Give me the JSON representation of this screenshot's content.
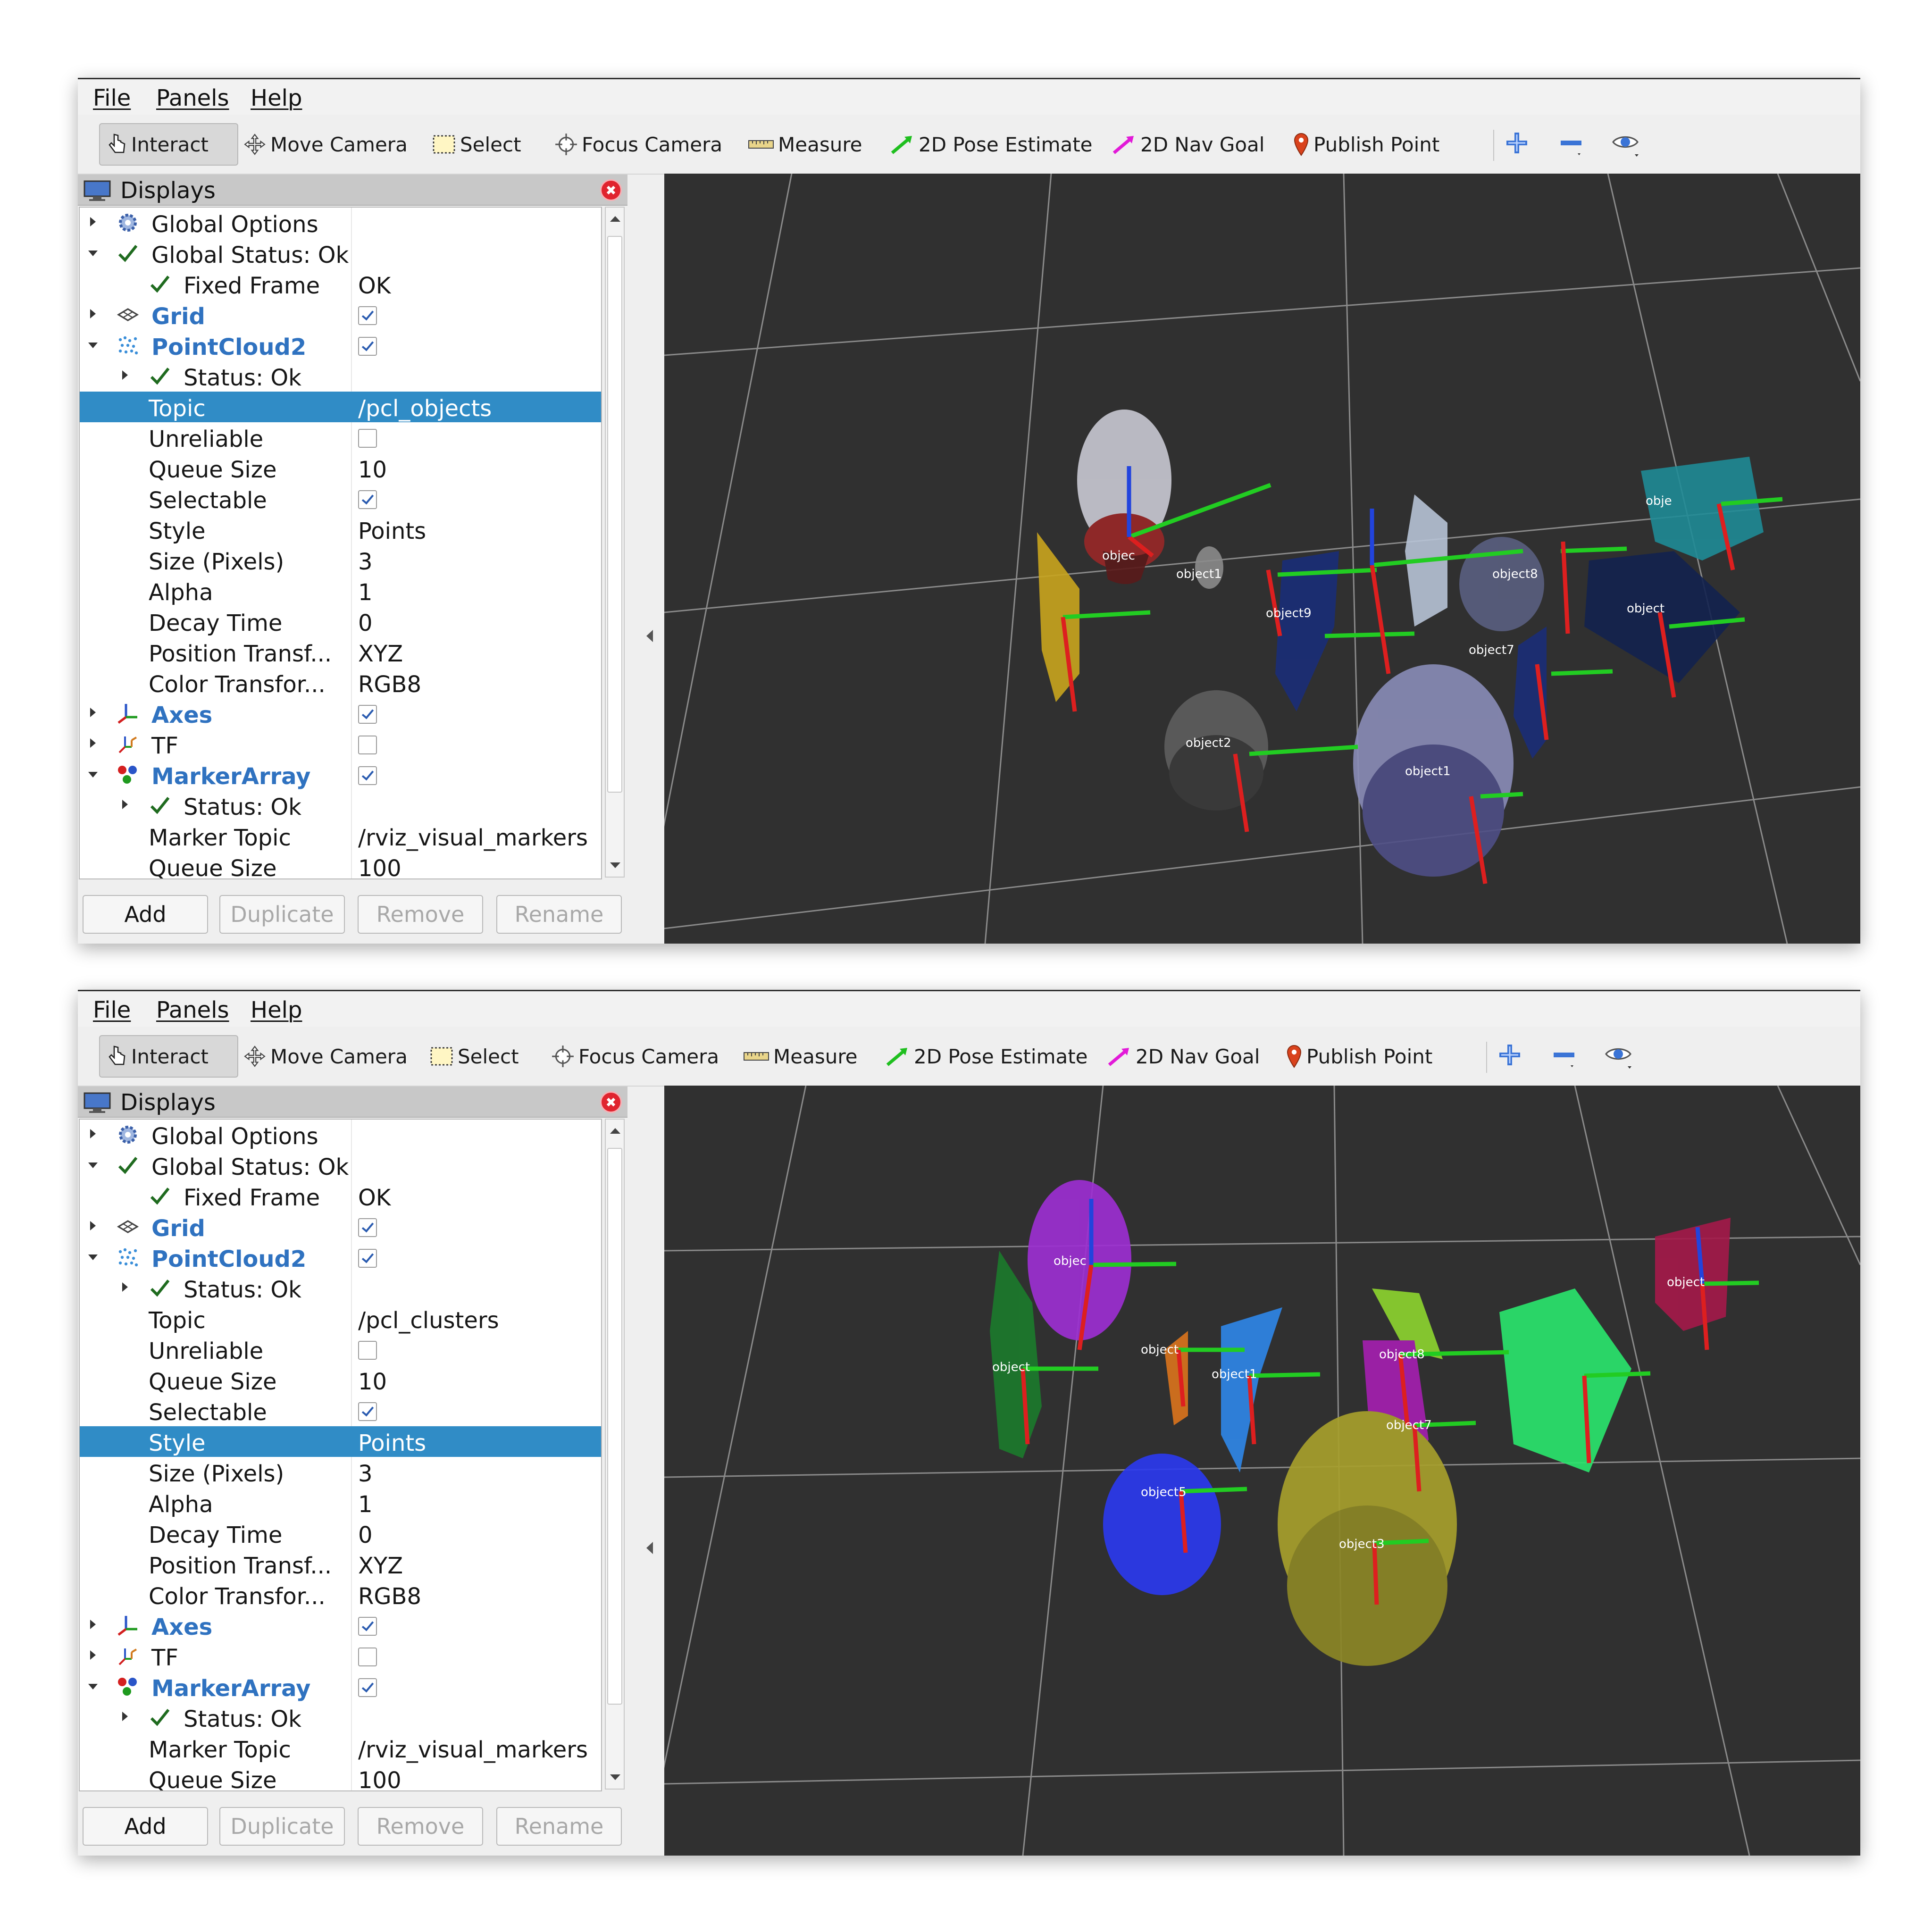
{
  "menu": [
    "File",
    "Panels",
    "Help"
  ],
  "toolbar": {
    "interact": "Interact",
    "move_camera": "Move Camera",
    "select": "Select",
    "focus_camera": "Focus Camera",
    "measure": "Measure",
    "pose_estimate": "2D Pose Estimate",
    "nav_goal": "2D Nav Goal",
    "publish_point": "Publish Point",
    "icons": [
      "plus-icon",
      "minus-icon",
      "eye-icon"
    ]
  },
  "panel": {
    "title": "Displays",
    "buttons": {
      "add": "Add",
      "duplicate": "Duplicate",
      "remove": "Remove",
      "rename": "Rename"
    }
  },
  "colors": {
    "selection": "#308cc6",
    "display_name": "#2f72c0",
    "viewport": "#303030"
  },
  "window1": {
    "selected_row": "Topic",
    "tree": {
      "global_options": "Global Options",
      "global_status": "Global Status: Ok",
      "fixed_frame": "Fixed Frame",
      "fixed_frame_value": "OK",
      "grid": "Grid",
      "pointcloud2": "PointCloud2",
      "status_ok": "Status: Ok",
      "topic": "Topic",
      "topic_value": "/pcl_objects",
      "unreliable": "Unreliable",
      "queue_size": "Queue Size",
      "queue_size_value": "10",
      "selectable": "Selectable",
      "style": "Style",
      "style_value": "Points",
      "size_pixels": "Size (Pixels)",
      "size_pixels_value": "3",
      "alpha": "Alpha",
      "alpha_value": "1",
      "decay_time": "Decay Time",
      "decay_time_value": "0",
      "position_transform": "Position Transf...",
      "position_transform_value": "XYZ",
      "color_transform": "Color Transfor...",
      "color_transform_value": "RGB8",
      "axes": "Axes",
      "tf": "TF",
      "marker_array": "MarkerArray",
      "marker_status": "Status: Ok",
      "marker_topic": "Marker Topic",
      "marker_topic_value": "/rviz_visual_markers",
      "marker_queue": "Queue Size",
      "marker_queue_value": "100"
    },
    "labels": [
      "objec",
      "object1",
      "object9",
      "object8",
      "object7",
      "obje",
      "object2",
      "object1",
      "object"
    ]
  },
  "window2": {
    "selected_row": "Style",
    "tree": {
      "global_options": "Global Options",
      "global_status": "Global Status: Ok",
      "fixed_frame": "Fixed Frame",
      "fixed_frame_value": "OK",
      "grid": "Grid",
      "pointcloud2": "PointCloud2",
      "status_ok": "Status: Ok",
      "topic": "Topic",
      "topic_value": "/pcl_clusters",
      "unreliable": "Unreliable",
      "queue_size": "Queue Size",
      "queue_size_value": "10",
      "selectable": "Selectable",
      "style": "Style",
      "style_value": "Points",
      "size_pixels": "Size (Pixels)",
      "size_pixels_value": "3",
      "alpha": "Alpha",
      "alpha_value": "1",
      "decay_time": "Decay Time",
      "decay_time_value": "0",
      "position_transform": "Position Transf...",
      "position_transform_value": "XYZ",
      "color_transform": "Color Transfor...",
      "color_transform_value": "RGB8",
      "axes": "Axes",
      "tf": "TF",
      "marker_array": "MarkerArray",
      "marker_status": "Status: Ok",
      "marker_topic": "Marker Topic",
      "marker_topic_value": "/rviz_visual_markers",
      "marker_queue": "Queue Size",
      "marker_queue_value": "100"
    },
    "labels": [
      "objec",
      "object",
      "object",
      "object1",
      "object8",
      "object7",
      "object5",
      "object3",
      "object"
    ]
  }
}
